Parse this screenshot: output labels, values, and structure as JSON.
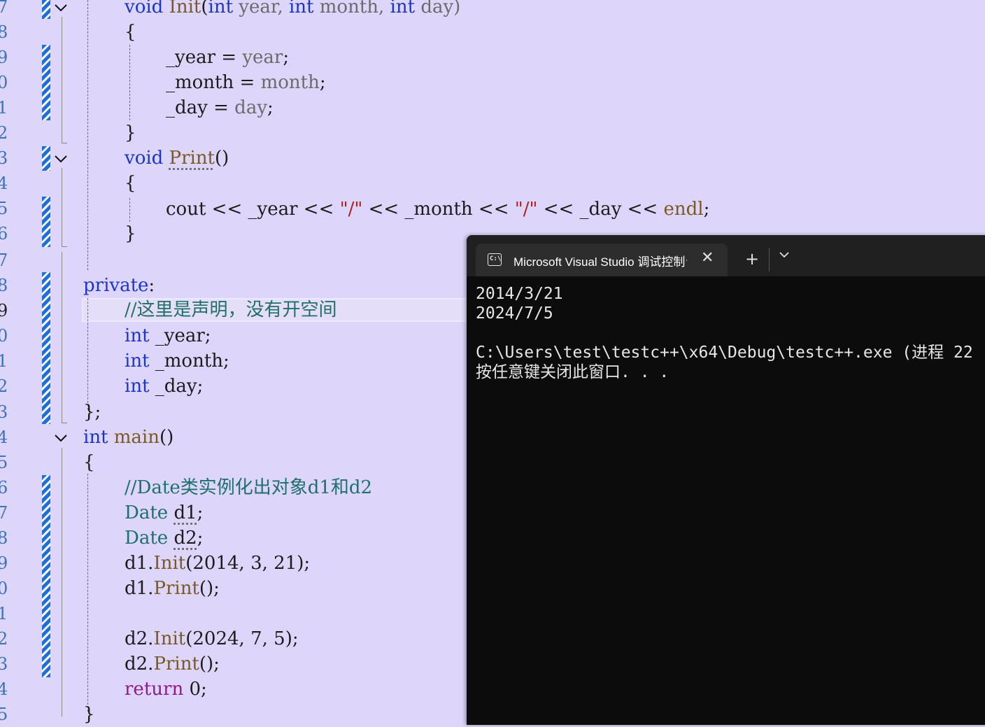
{
  "editor": {
    "line_numbers": [
      "7",
      "8",
      "9",
      "0",
      "1",
      "2",
      "3",
      "4",
      "5",
      "6",
      "7",
      "8",
      "9",
      "0",
      "1",
      "2",
      "3",
      "4",
      "5",
      "6",
      "7",
      "8",
      "9",
      "0",
      "1",
      "2",
      "3",
      "4",
      "5"
    ],
    "code": {
      "l7": {
        "void": "void",
        "init": "Init",
        "open": "(",
        "int1": "int",
        "year": " year, ",
        "int2": "int",
        "month": " month, ",
        "int3": "int",
        "day": " day)"
      },
      "l8": "{",
      "l9": {
        "var": "_year",
        "op": " = ",
        "val": "year",
        ";": ";"
      },
      "l10": {
        "var": "_month",
        "op": " = ",
        "val": "month",
        ";": ";"
      },
      "l11": {
        "var": "_day",
        "op": " = ",
        "val": "day",
        ";": ";"
      },
      "l12": "}",
      "l13": {
        "void": "void",
        "fn": "Print",
        "paren": "()"
      },
      "l14": "{",
      "l15": {
        "cout": "cout << _year << ",
        "s1": "\"/\"",
        "m1": " << _month << ",
        "s2": "\"/\"",
        "m2": " << _day << ",
        "endl": "endl",
        ";": ";"
      },
      "l16": "}",
      "l18": {
        "private": "private",
        ":": ":"
      },
      "l19": "//这里是声明，没有开空间",
      "l20": {
        "int": "int",
        "rest": " _year;"
      },
      "l21": {
        "int": "int",
        "rest": " _month;"
      },
      "l22": {
        "int": "int",
        "rest": " _day;"
      },
      "l23": "};",
      "l24": {
        "int": "int",
        "main": "main",
        "paren": "()"
      },
      "l25": "{",
      "l26": "//Date类实例化出对象d1和d2",
      "l27": {
        "type": "Date",
        "var": "d1",
        ";": ";"
      },
      "l28": {
        "type": "Date",
        "var": "d2",
        ";": ";"
      },
      "l29": {
        "obj": "d1.",
        "fn": "Init",
        "args": "(2014, 3, 21);"
      },
      "l30": {
        "obj": "d1.",
        "fn": "Print",
        "args": "();"
      },
      "l32": {
        "obj": "d2.",
        "fn": "Init",
        "args": "(2024, 7, 5);"
      },
      "l33": {
        "obj": "d2.",
        "fn": "Print",
        "args": "();"
      },
      "l34": {
        "ret": "return",
        "rest": " 0;"
      },
      "l35": "}"
    }
  },
  "terminal": {
    "tab_title": "Microsoft Visual Studio 调试控制台",
    "icon": "console-icon",
    "close_glyph": "✕",
    "add_glyph": "+",
    "dropdown_glyph": "⌄",
    "output": [
      "2014/3/21",
      "2024/7/5",
      "",
      "C:\\Users\\test\\testc++\\x64\\Debug\\testc++.exe (进程 22",
      "按任意键关闭此窗口. . ."
    ]
  }
}
